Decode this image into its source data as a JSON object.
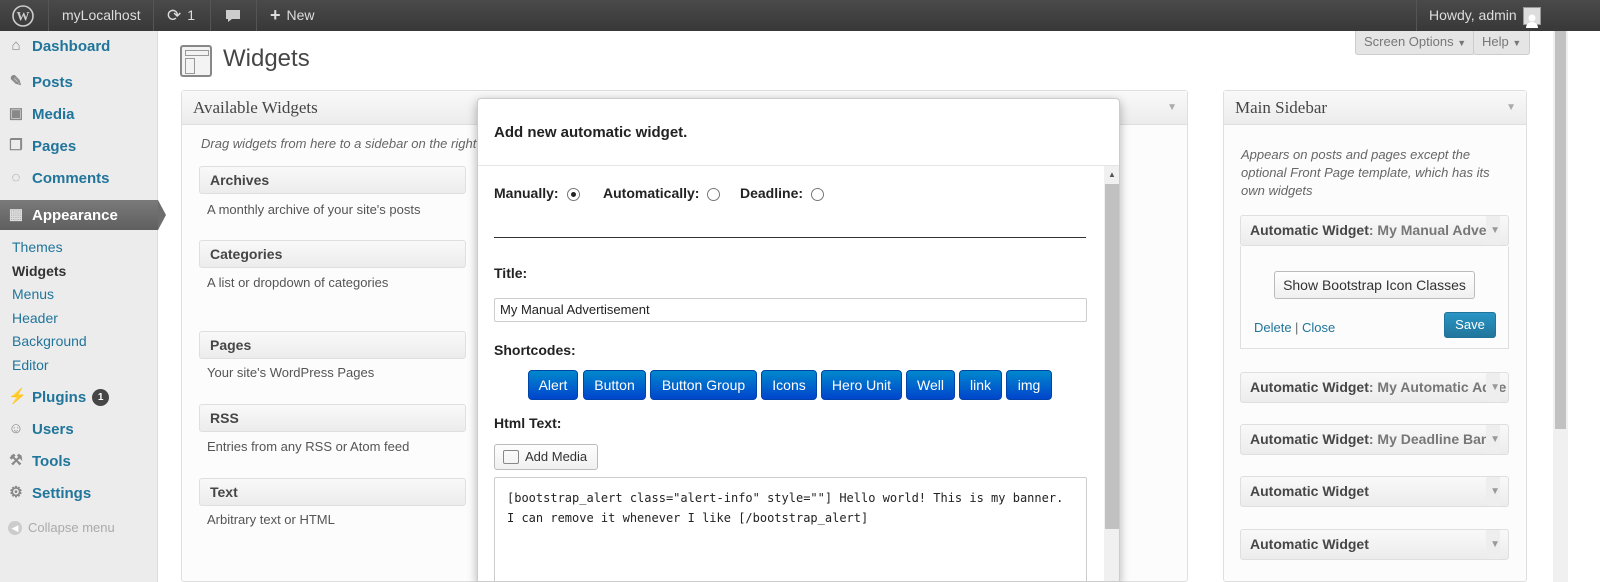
{
  "adminbar": {
    "site_name": "myLocalhost",
    "updates_count": "1",
    "new_label": "New",
    "howdy": "Howdy, admin"
  },
  "menu": {
    "dashboard": "Dashboard",
    "posts": "Posts",
    "media": "Media",
    "pages": "Pages",
    "comments": "Comments",
    "appearance": "Appearance",
    "sub": [
      "Themes",
      "Widgets",
      "Menus",
      "Header",
      "Background",
      "Editor"
    ],
    "plugins": "Plugins",
    "plugins_badge": "1",
    "users": "Users",
    "tools": "Tools",
    "settings": "Settings",
    "collapse": "Collapse menu"
  },
  "page": {
    "title": "Widgets",
    "screen_options": "Screen Options",
    "help": "Help"
  },
  "available": {
    "title": "Available Widgets",
    "hint": "Drag widgets from here to a sidebar on the right t",
    "widgets": [
      {
        "title": "Archives",
        "desc": "A monthly archive of your site's posts"
      },
      {
        "title": "Categories",
        "desc": "A list or dropdown of categories"
      },
      {
        "title": "Pages",
        "desc": "Your site's WordPress Pages"
      },
      {
        "title": "RSS",
        "desc": "Entries from any RSS or Atom feed"
      },
      {
        "title": "Text",
        "desc": "Arbitrary text or HTML"
      }
    ]
  },
  "modal": {
    "title": "Add new automatic widget.",
    "manually": "Manually:",
    "automatically": "Automatically:",
    "deadline": "Deadline:",
    "selected_mode": "Manually",
    "title_label": "Title:",
    "title_value": "My Manual Advertisement",
    "shortcodes_label": "Shortcodes:",
    "shortcodes": [
      "Alert",
      "Button",
      "Button Group",
      "Icons",
      "Hero Unit",
      "Well",
      "link",
      "img"
    ],
    "html_label": "Html Text:",
    "add_media": "Add Media",
    "html_value": "[bootstrap_alert class=\"alert-info\" style=\"\"] Hello world! This is my banner. I can remove it whenever I like [/bootstrap_alert]"
  },
  "sidebar": {
    "title": "Main Sidebar",
    "description": "Appears on posts and pages except the optional Front Page template, which has its own widgets",
    "widgets": [
      {
        "title": "Automatic Widget",
        "subtitle": ": My Manual Adverti"
      },
      {
        "title": "Automatic Widget",
        "subtitle": ": My Automatic Adve"
      },
      {
        "title": "Automatic Widget",
        "subtitle": ": My Deadline Bann"
      },
      {
        "title": "Automatic Widget",
        "subtitle": ""
      },
      {
        "title": "Automatic Widget",
        "subtitle": ""
      }
    ],
    "icon_button": "Show Bootstrap Icon Classes",
    "delete": "Delete",
    "close": "Close",
    "separator": "|",
    "save": "Save"
  },
  "colors": {
    "adminbar": "#464646",
    "link": "#21759b",
    "shortcode_button": "#0066cc",
    "save_button": "#21759b"
  }
}
